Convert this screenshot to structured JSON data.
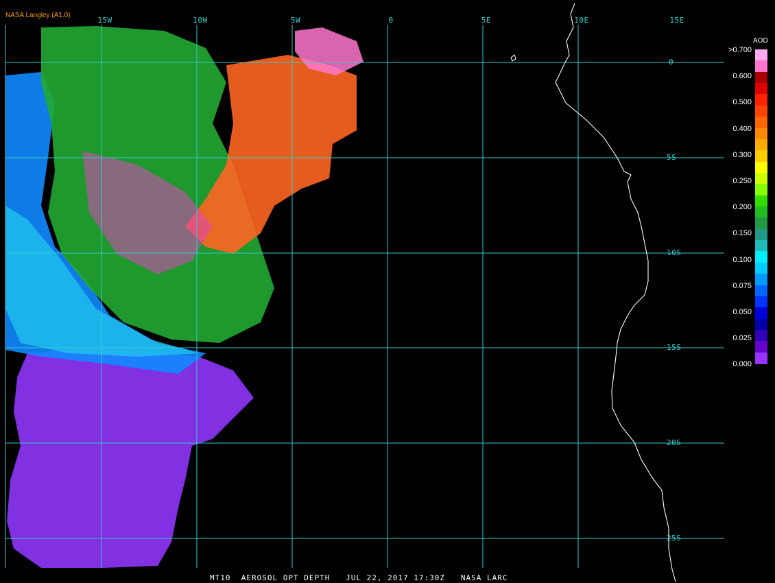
{
  "credit": "NASA Langley (A1.0)",
  "lon_labels": [
    "15W",
    "10W",
    "5W",
    "0",
    "5E",
    "10E",
    "15E"
  ],
  "lat_labels": [
    "0",
    "5S",
    "10S",
    "15S",
    "20S",
    "25S"
  ],
  "legend": {
    "title": "AOD",
    "values": [
      ">0.700",
      "0.600",
      "0.500",
      "0.400",
      "0.300",
      "0.250",
      "0.200",
      "0.150",
      "0.100",
      "0.075",
      "0.050",
      "0.025",
      "0.000"
    ],
    "colors": [
      "#ffaaee",
      "#ff77cc",
      "#aa0000",
      "#dd0000",
      "#ff2200",
      "#ff4400",
      "#ff6600",
      "#ff8800",
      "#ffaa00",
      "#ffcc00",
      "#ffff00",
      "#ccff00",
      "#88ff00",
      "#33dd00",
      "#22bb22",
      "#229944",
      "#229988",
      "#22bbbb",
      "#00eeff",
      "#00ccff",
      "#0099ff",
      "#0066ff",
      "#0033ff",
      "#0000dd",
      "#0000aa",
      "#3300bb",
      "#6600cc",
      "#9933ff"
    ]
  },
  "footer": "MT10  AEROSOL OPT DEPTH   JUL 22, 2017 17:30Z   NASA LARC",
  "colors": {
    "grid": "#33cccc",
    "coast": "#ffffff",
    "credit": "#ff9900"
  }
}
